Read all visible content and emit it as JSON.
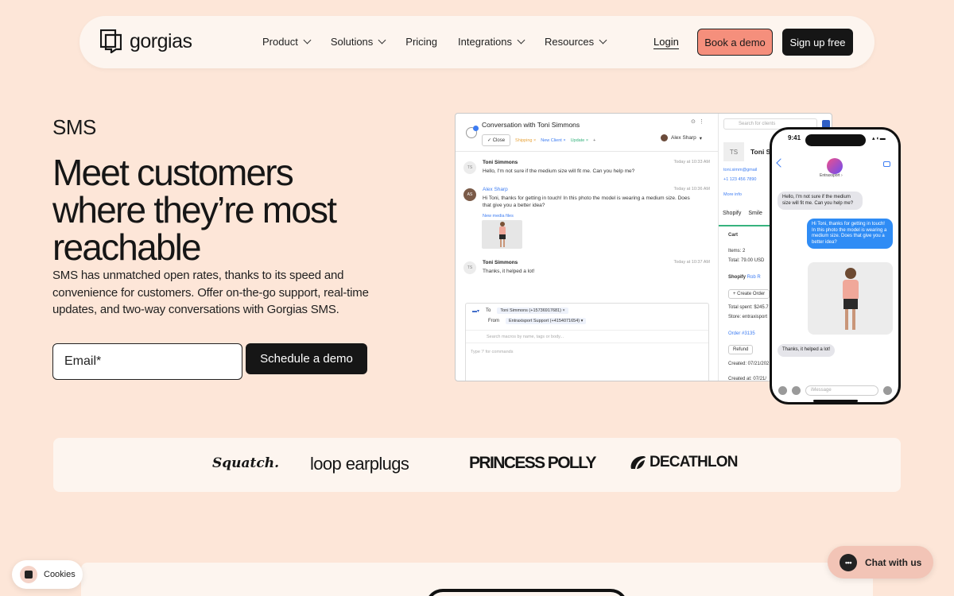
{
  "nav": {
    "brand": "gorgias",
    "links": [
      "Product",
      "Solutions",
      "Pricing",
      "Integrations",
      "Resources"
    ],
    "login": "Login",
    "book_demo": "Book a demo",
    "sign_up": "Sign up free"
  },
  "hero": {
    "eyebrow": "SMS",
    "headline": "Meet customers where they’re most reachable",
    "lead": "SMS has unmatched open rates, thanks to its speed and convenience for customers. Offer on-the-go support, real-time updates, and two-way conversations with Gorgias SMS.",
    "email_placeholder": "Email*",
    "cta": "Schedule a demo"
  },
  "helpdesk": {
    "title": "Conversation with Toni Simmons",
    "close": "Close",
    "tags": [
      "Shipping",
      "New Client",
      "Update"
    ],
    "agent": "Alex Sharp",
    "messages": [
      {
        "initials": "TS",
        "name": "Toni Simmons",
        "time": "Today at 10:33 AM",
        "text": "Hello, I'm not sure if the medium size will fit me. Can you help me?"
      },
      {
        "initials": "AS",
        "name": "Alex Sharp",
        "time": "Today at 10:36 AM",
        "text": "Hi Toni, thanks for getting in touch! In this photo the model is wearing a medium size. Does that give you a better idea?",
        "media_link": "New media files"
      },
      {
        "initials": "TS",
        "name": "Toni Simmons",
        "time": "Today at 10:37 AM",
        "text": "Thanks, it helped a lot!"
      }
    ],
    "composer": {
      "to_label": "To",
      "to_value": "Toni Simmons (+15736917681)",
      "from_label": "From",
      "from_value": "Entraxisport Support (+4154071654)",
      "macro_placeholder": "Search macros by name, tags or body...",
      "type_placeholder": "Type '/' for commands"
    },
    "sidebar": {
      "search_placeholder": "Search for clients",
      "initials": "TS",
      "name": "Toni Si",
      "email": "toni.simm@gmail",
      "phone": "+1 123 456 7890",
      "more": "More info",
      "tabs": [
        "Shopify",
        "Smile"
      ],
      "cart": "Cart",
      "items": "Items: 2",
      "total": "Total: 79.00 USD",
      "shopify": "Shopify",
      "shopify_user": "Rob R",
      "create_order": "+ Create Order",
      "total_spent": "Total spent: $245.7",
      "store": "Store: entraxisport",
      "order": "Order #3135",
      "refund": "Refund",
      "created": "Created: 07/21/202",
      "created_at": "Created at: 07/21/"
    }
  },
  "phone": {
    "time": "9:41",
    "brand": "Entraxsport",
    "msg_in_1": "Hello, I'm not sure if the medium size will fit me. Can you help me?",
    "msg_out": "Hi Toni, thanks for getting in touch! In this photo the model is wearing a medium size. Does that give you a better idea?",
    "msg_in_2": "Thanks, it helped a lot!",
    "input_placeholder": "iMessage"
  },
  "logos": [
    "Squatch.",
    "loop earplugs",
    "PRINCESS POLLY",
    "DECATHLON"
  ],
  "cookies": "Cookies",
  "chat": "Chat with us",
  "colors": {
    "page_bg": "#fde6d8",
    "accent": "#f58f7c",
    "dark": "#161616",
    "link_blue": "#3d7cf2"
  }
}
